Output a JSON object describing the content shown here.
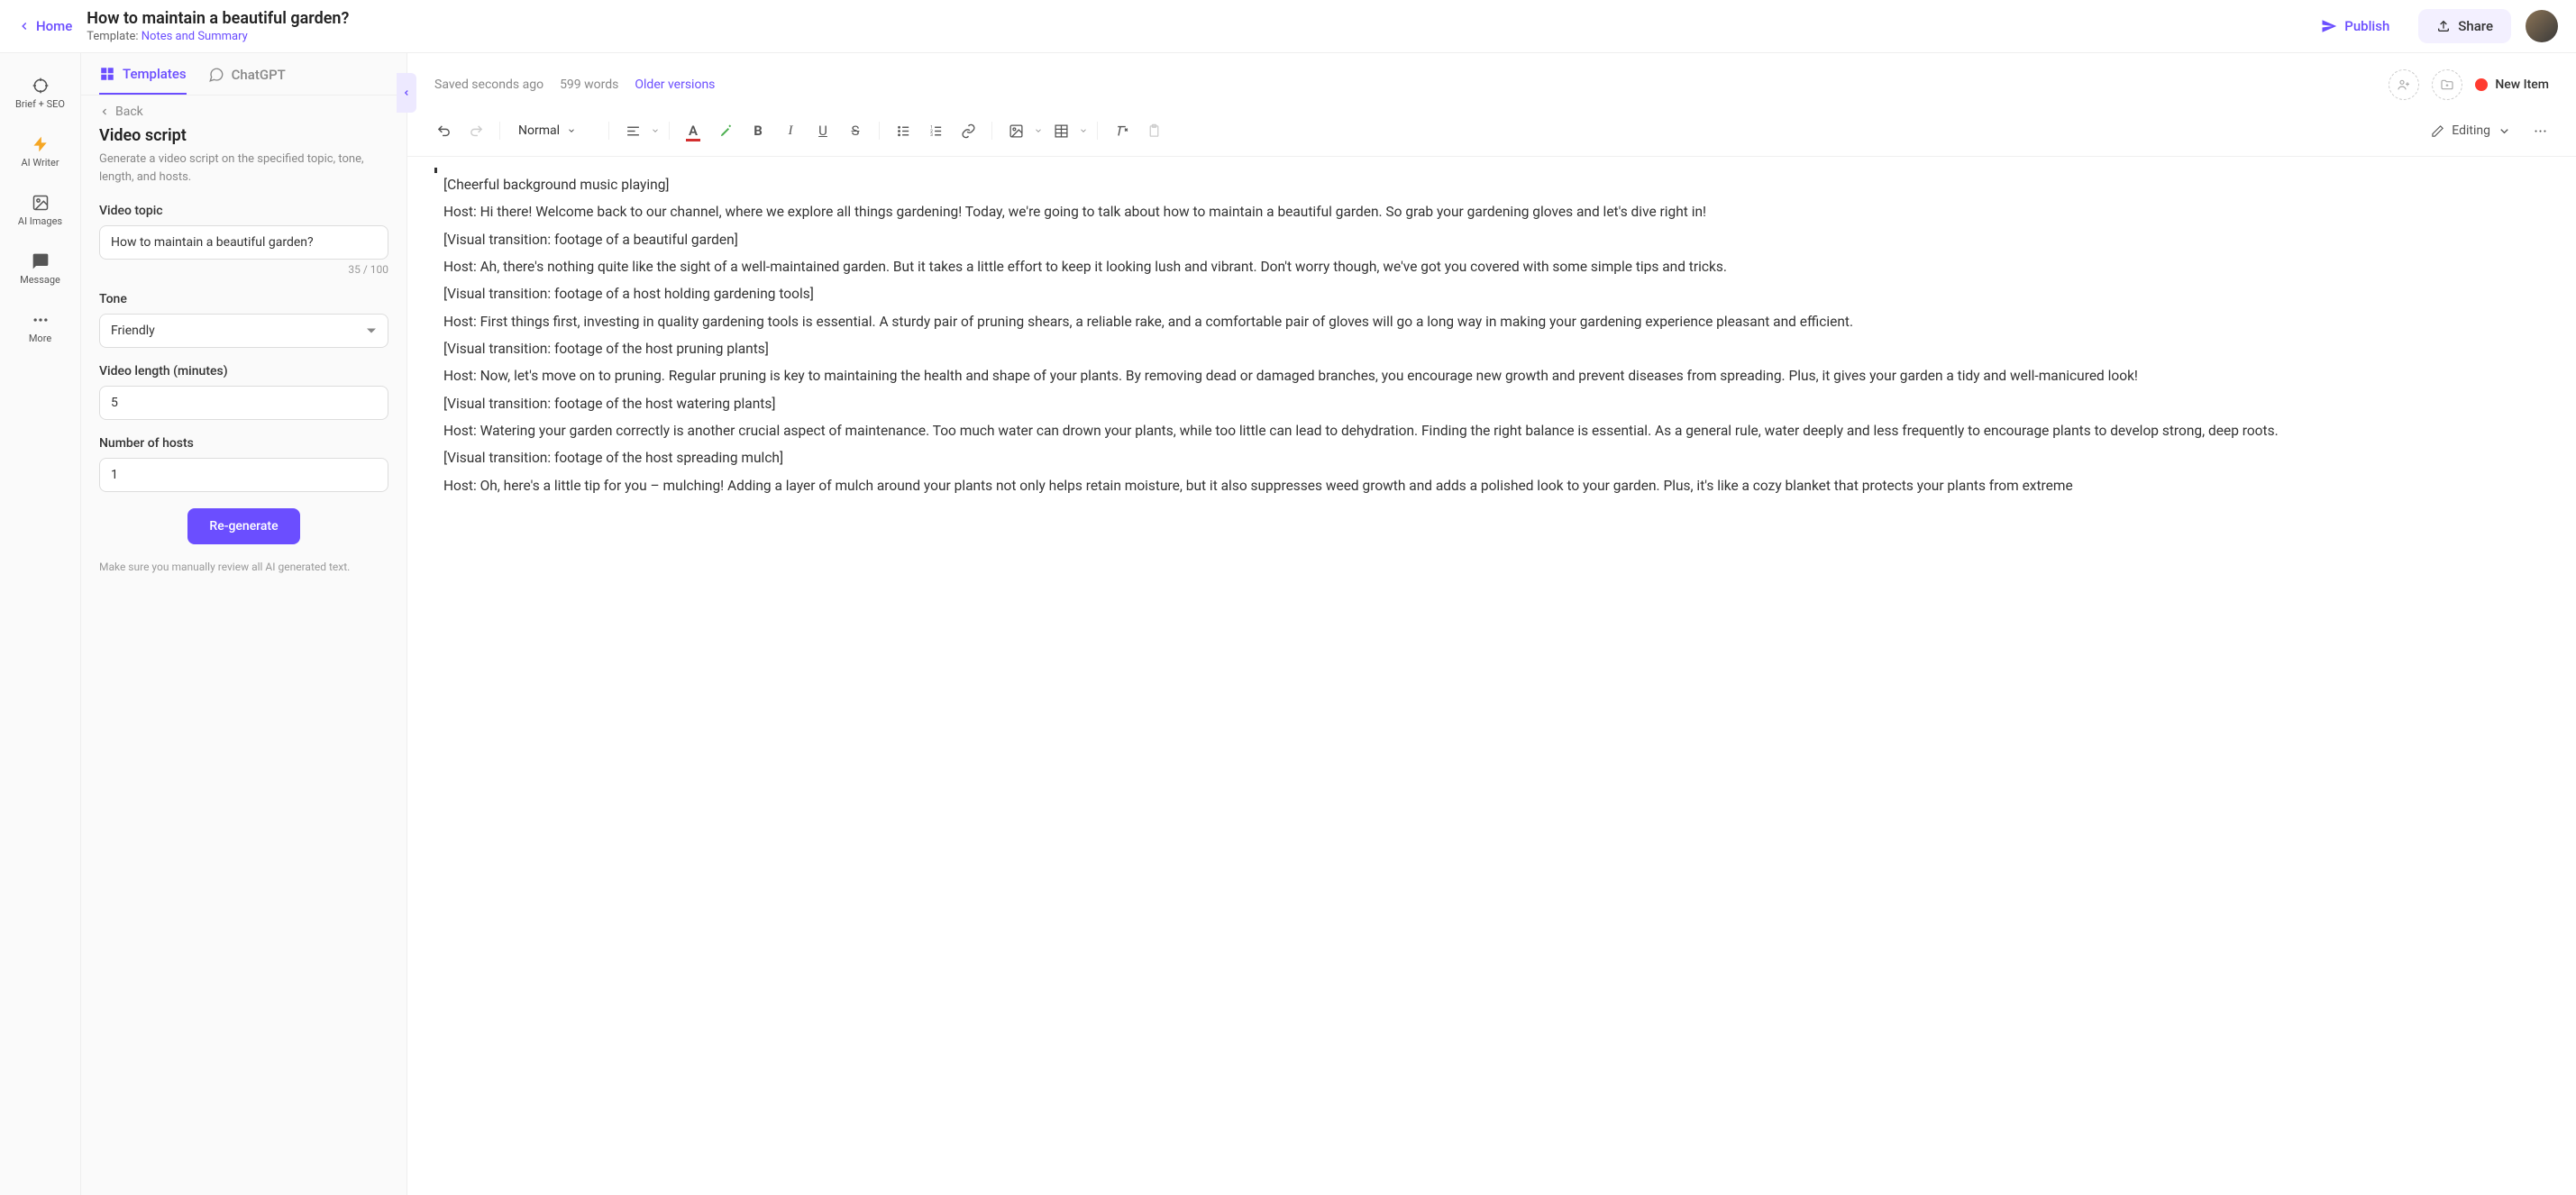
{
  "header": {
    "home": "Home",
    "title": "How to maintain a beautiful garden?",
    "template_prefix": "Template: ",
    "template_name": "Notes and Summary",
    "publish": "Publish",
    "share": "Share"
  },
  "rail": {
    "brief": "Brief + SEO",
    "writer": "AI Writer",
    "images": "AI Images",
    "message": "Message",
    "more": "More"
  },
  "sidebar": {
    "tabs": {
      "templates": "Templates",
      "chatgpt": "ChatGPT"
    },
    "back": "Back",
    "title": "Video script",
    "desc": "Generate a video script on the specified topic, tone, length, and hosts.",
    "topic_label": "Video topic",
    "topic_value": "How to maintain a beautiful garden?",
    "char_count": "35 / 100",
    "tone_label": "Tone",
    "tone_value": "Friendly",
    "length_label": "Video length (minutes)",
    "length_value": "5",
    "hosts_label": "Number of hosts",
    "hosts_value": "1",
    "regenerate": "Re-generate",
    "review_note": "Make sure you manually review all AI generated text."
  },
  "editor": {
    "saved": "Saved seconds ago",
    "words": "599 words",
    "versions": "Older versions",
    "new_item": "New Item",
    "style": "Normal",
    "editing_mode": "Editing"
  },
  "doc": {
    "p1": "[Cheerful background music playing]",
    "p2": "Host: Hi there! Welcome back to our channel, where we explore all things gardening! Today, we're going to talk about how to maintain a beautiful garden. So grab your gardening gloves and let's dive right in!",
    "p3": "[Visual transition: footage of a beautiful garden]",
    "p4": "Host: Ah, there's nothing quite like the sight of a well-maintained garden. But it takes a little effort to keep it looking lush and vibrant. Don't worry though, we've got you covered with some simple tips and tricks.",
    "p5": "[Visual transition: footage of a host holding gardening tools]",
    "p6": "Host: First things first, investing in quality gardening tools is essential. A sturdy pair of pruning shears, a reliable rake, and a comfortable pair of gloves will go a long way in making your gardening experience pleasant and efficient.",
    "p7": "[Visual transition: footage of the host pruning plants]",
    "p8": "Host: Now, let's move on to pruning. Regular pruning is key to maintaining the health and shape of your plants. By removing dead or damaged branches, you encourage new growth and prevent diseases from spreading. Plus, it gives your garden a tidy and well-manicured look!",
    "p9": "[Visual transition: footage of the host watering plants]",
    "p10": "Host: Watering your garden correctly is another crucial aspect of maintenance. Too much water can drown your plants, while too little can lead to dehydration. Finding the right balance is essential. As a general rule, water deeply and less frequently to encourage plants to develop strong, deep roots.",
    "p11": "[Visual transition: footage of the host spreading mulch]",
    "p12": "Host: Oh, here's a little tip for you – mulching! Adding a layer of mulch around your plants not only helps retain moisture, but it also suppresses weed growth and adds a polished look to your garden. Plus, it's like a cozy blanket that protects your plants from extreme"
  }
}
